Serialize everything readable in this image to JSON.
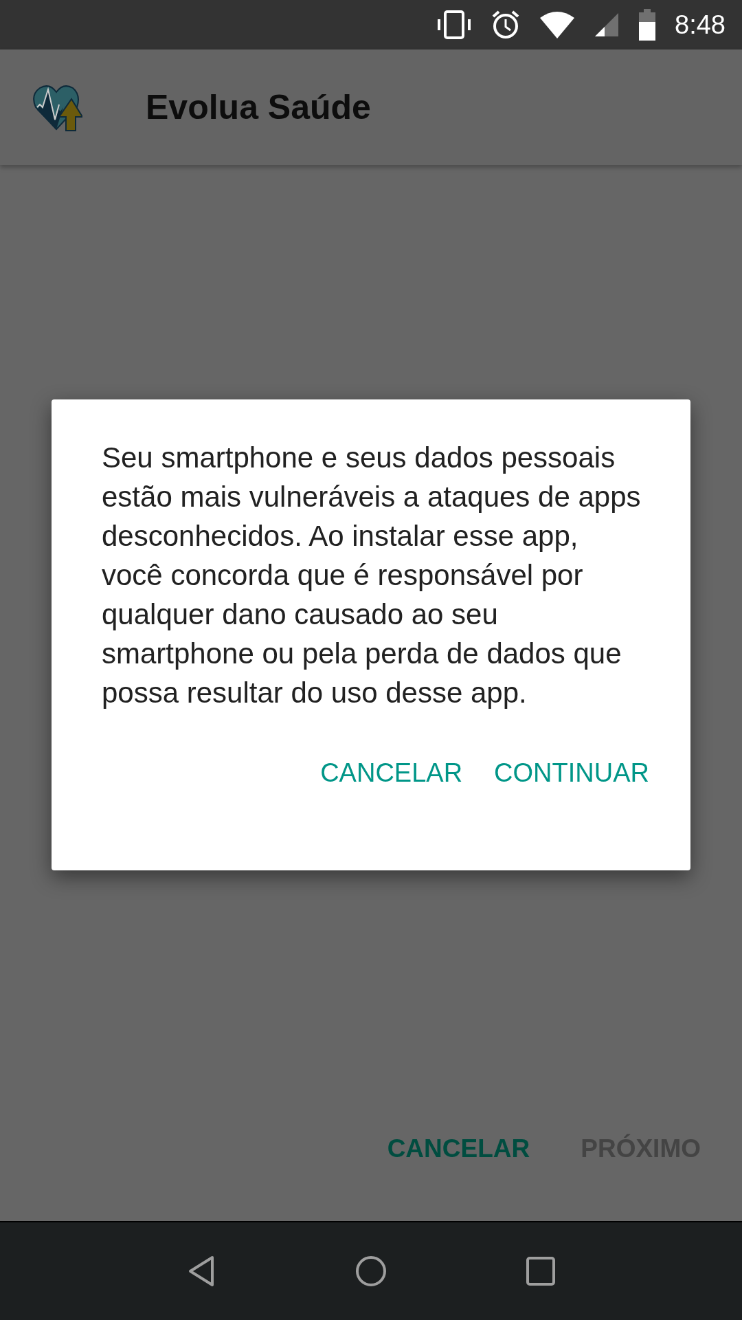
{
  "status_bar": {
    "time": "8:48"
  },
  "app_bar": {
    "title": "Evolua Saúde"
  },
  "dialog": {
    "message": "Seu smartphone e seus dados pessoais estão mais vulneráveis a ataques de apps desconhecidos. Ao instalar esse app, você concorda que é responsável por qualquer dano causado ao seu smartphone ou pela perda de dados que possa resultar do uso desse app.",
    "buttons": [
      {
        "label": "CANCELAR"
      },
      {
        "label": "CONTINUAR"
      }
    ]
  },
  "footer_buttons": [
    {
      "label": "CANCELAR",
      "disabled": false
    },
    {
      "label": "PRÓXIMO",
      "disabled": true
    }
  ]
}
